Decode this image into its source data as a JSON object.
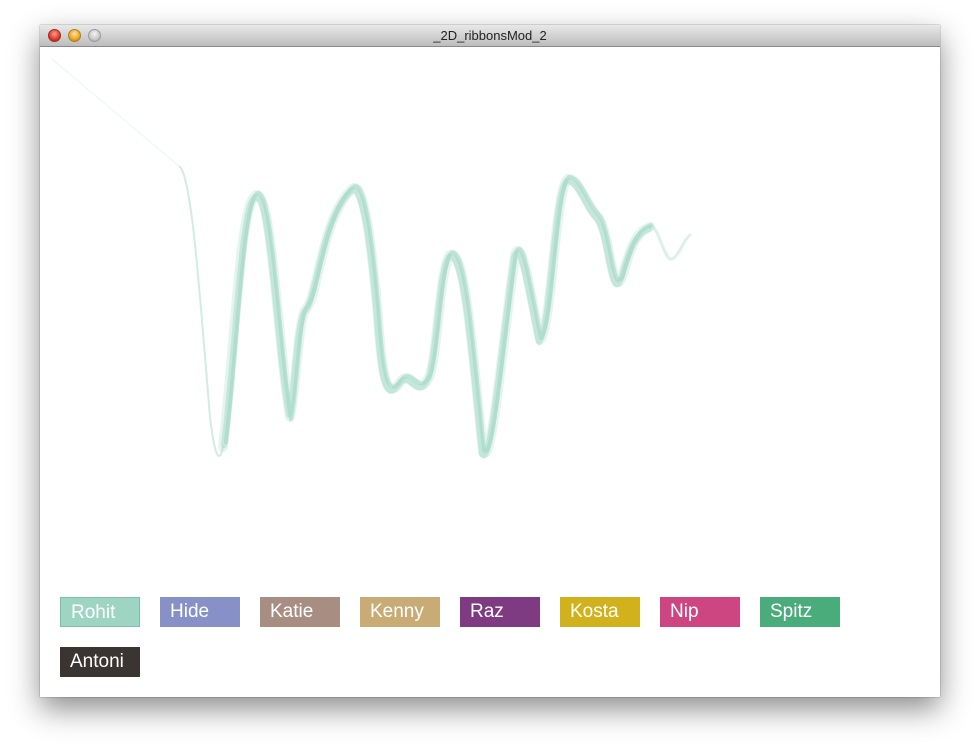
{
  "window": {
    "title": "_2D_ribbonsMod_2"
  },
  "ribbon": {
    "color": "#9dd5c2",
    "owner": "Rohit"
  },
  "buttons": [
    {
      "label": "Rohit",
      "color": "#9dd5c2"
    },
    {
      "label": "Hide",
      "color": "#8790c7"
    },
    {
      "label": "Katie",
      "color": "#a88e82"
    },
    {
      "label": "Kenny",
      "color": "#c8ab75"
    },
    {
      "label": "Raz",
      "color": "#7f3b82"
    },
    {
      "label": "Kosta",
      "color": "#d1b21c"
    },
    {
      "label": "Nip",
      "color": "#cd4682"
    },
    {
      "label": "Spitz",
      "color": "#4aab7b"
    },
    {
      "label": "Antoni",
      "color": "#3a3433"
    }
  ]
}
